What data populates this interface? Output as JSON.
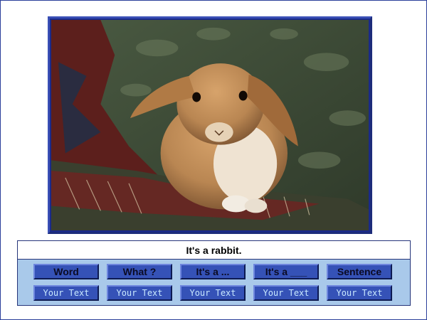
{
  "photo": {
    "subject_icon": "rabbit-photo",
    "colors": {
      "frame": "#3a4fb5",
      "background": "#3b4a34",
      "fur": "#b98652",
      "blanket": "#5c1f1c"
    }
  },
  "sentence": {
    "text": "It's a rabbit."
  },
  "toolbar": {
    "buttons": [
      {
        "label": "Word"
      },
      {
        "label": "What ?"
      },
      {
        "label": "It's a ..."
      },
      {
        "label": "It's a ___"
      },
      {
        "label": "Sentence"
      }
    ],
    "text_fields": [
      {
        "label": "Your Text"
      },
      {
        "label": "Your Text"
      },
      {
        "label": "Your Text"
      },
      {
        "label": "Your Text"
      },
      {
        "label": "Your Text"
      }
    ]
  },
  "colors": {
    "button": "#3552b7",
    "panel": "#a9c9ea",
    "border": "#26357a",
    "text_field_text": "#c8e8ff"
  }
}
